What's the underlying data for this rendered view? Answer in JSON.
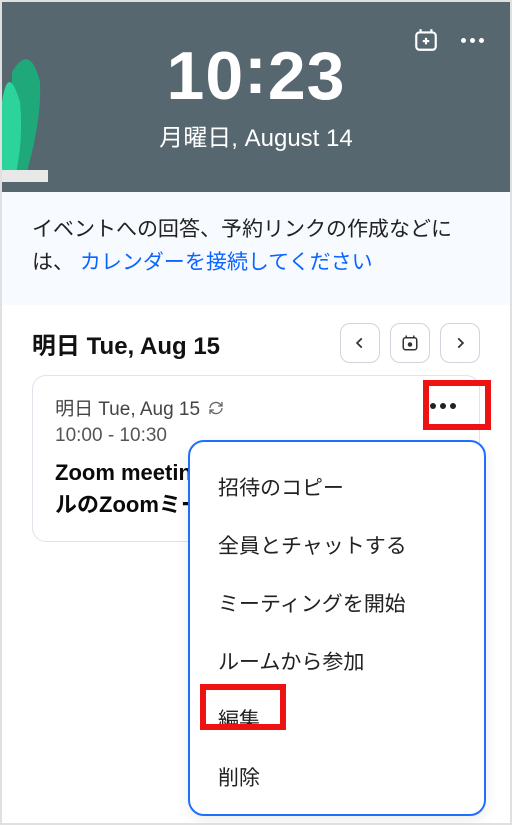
{
  "header": {
    "time": "10",
    "colon": ":",
    "minutes": "23",
    "date": "月曜日, August 14"
  },
  "banner": {
    "text_a": "イベントへの回答、予約リンクの作成などには、",
    "link_text": "カレンダーを接続してください"
  },
  "section": {
    "title": "明日 Tue, Aug 15"
  },
  "event": {
    "day_label": "明日 Tue, Aug 15",
    "time_range": "10:00 - 10:30",
    "title_line1": "Zoom meetin",
    "title_line2": "ルのZoomミー"
  },
  "menu": {
    "items": [
      "招待のコピー",
      "全員とチャットする",
      "ミーティングを開始",
      "ルームから参加",
      "編集",
      "削除"
    ]
  }
}
